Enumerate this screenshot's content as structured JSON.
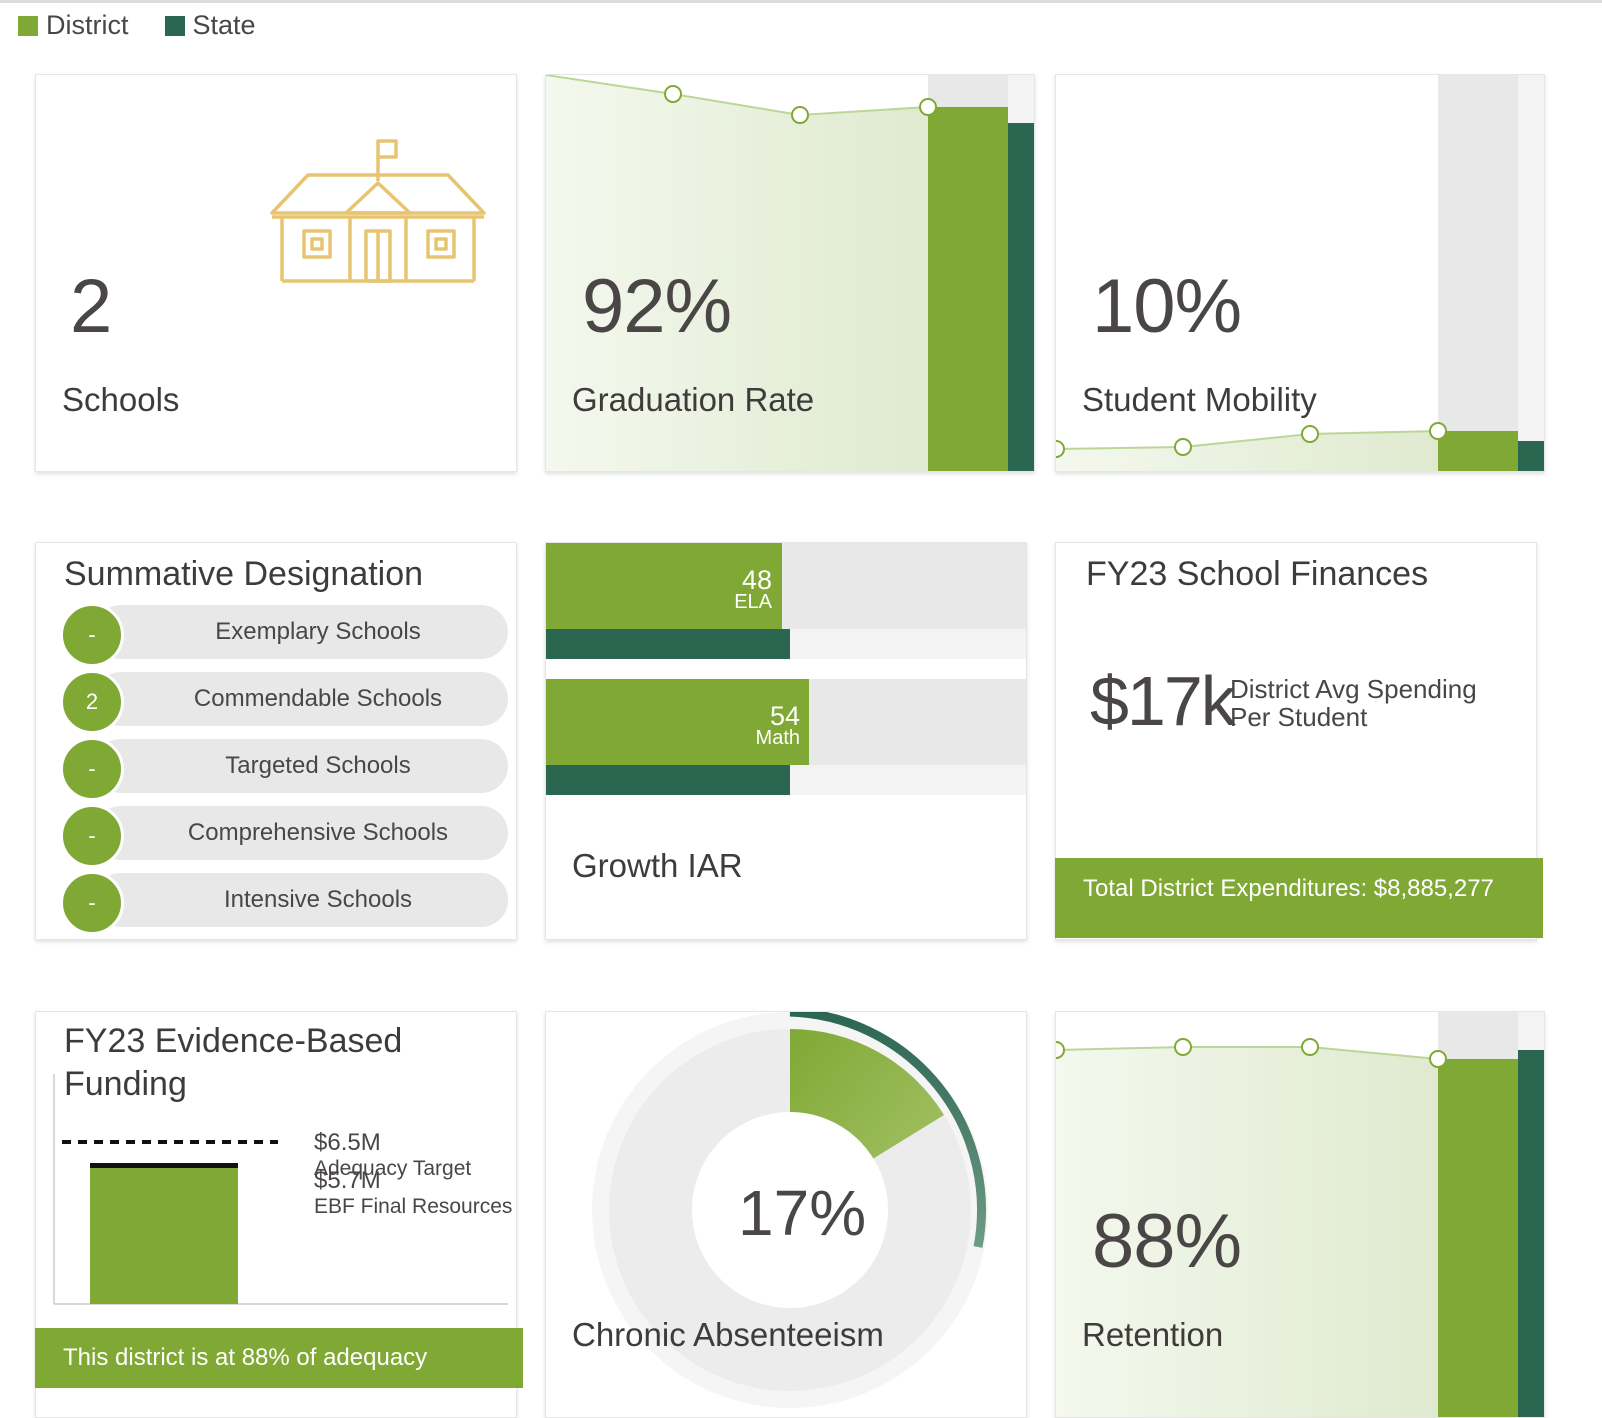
{
  "legend": {
    "district": "District",
    "state": "State"
  },
  "colors": {
    "district": "#80a834",
    "state": "#2b6650",
    "gold": "#e7c570",
    "track": "#e9e8e8"
  },
  "schools": {
    "count": "2",
    "label": "Schools",
    "icon": "schoolhouse-icon"
  },
  "graduation": {
    "value": "92%",
    "label": "Graduation Rate"
  },
  "mobility": {
    "value": "10%",
    "label": "Student Mobility"
  },
  "summative": {
    "title": "Summative Designation",
    "rows": [
      {
        "count": "-",
        "label": "Exemplary Schools"
      },
      {
        "count": "2",
        "label": "Commendable Schools"
      },
      {
        "count": "-",
        "label": "Targeted Schools"
      },
      {
        "count": "-",
        "label": "Comprehensive Schools"
      },
      {
        "count": "-",
        "label": "Intensive Schools"
      }
    ]
  },
  "growth": {
    "label": "Growth IAR",
    "ela": {
      "value": "48",
      "name": "ELA"
    },
    "math": {
      "value": "54",
      "name": "Math"
    }
  },
  "finances": {
    "title": "FY23 School Finances",
    "amount": "$17k",
    "desc_line1": "District Avg Spending",
    "desc_line2": "Per Student",
    "footer": "Total District Expenditures: $8,885,277"
  },
  "ebf": {
    "title_line1": "FY23 Evidence-Based",
    "title_line2": "Funding",
    "target_value": "$6.5M",
    "target_label": "Adequacy Target",
    "resources_value": "$5.7M",
    "resources_label": "EBF Final Resources",
    "footer": "This district is at 88% of adequacy"
  },
  "absenteeism": {
    "value": "17%",
    "label": "Chronic Absenteeism"
  },
  "retention": {
    "value": "88%",
    "label": "Retention"
  }
}
